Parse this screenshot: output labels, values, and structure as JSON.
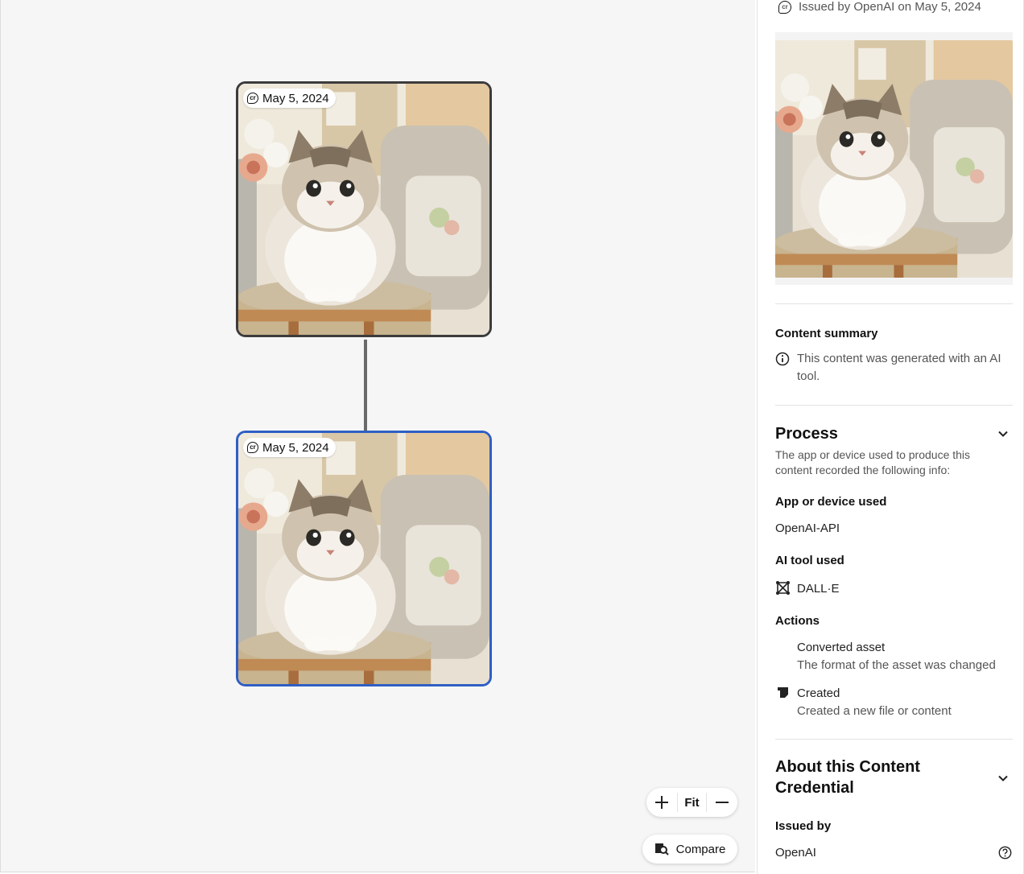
{
  "canvas": {
    "nodes": [
      {
        "date": "May 5, 2024",
        "selected": false
      },
      {
        "date": "May 5, 2024",
        "selected": true
      }
    ],
    "zoom": {
      "plus": "+",
      "fit": "Fit",
      "minus": "—"
    },
    "compare_label": "Compare"
  },
  "panel": {
    "issued_line": "Issued by OpenAI on May 5, 2024",
    "content_summary": {
      "title": "Content summary",
      "text": "This content was generated with an AI tool."
    },
    "process": {
      "title": "Process",
      "description": "The app or device used to produce this content recorded the following info:",
      "app_label": "App or device used",
      "app_value": "OpenAI-API",
      "ai_tool_label": "AI tool used",
      "ai_tool_value": "DALL·E",
      "actions_label": "Actions",
      "actions": [
        {
          "title": "Converted asset",
          "description": "The format of the asset was changed"
        },
        {
          "title": "Created",
          "description": "Created a new file or content"
        }
      ]
    },
    "about": {
      "title_line1": "About this Content",
      "title_line2": "Credential",
      "issued_by_label": "Issued by",
      "issued_by_value": "OpenAI"
    }
  },
  "colors": {
    "selected_border": "#2f5fc4",
    "node_border": "#3c3c3c",
    "connector": "#6a6a6a"
  }
}
